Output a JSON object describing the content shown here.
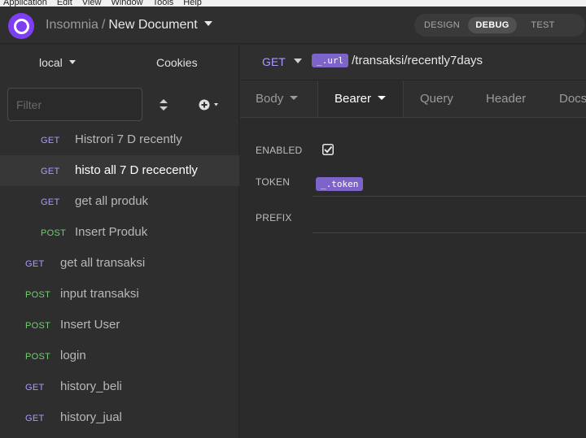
{
  "menubar": [
    "Application",
    "Edit",
    "View",
    "Window",
    "Tools",
    "Help"
  ],
  "header": {
    "app_name": "Insomnia",
    "separator": "/",
    "document": "New Document",
    "modes": [
      "DESIGN",
      "DEBUG",
      "TEST"
    ],
    "active_mode": "DEBUG"
  },
  "sidebar": {
    "environment": "local",
    "cookies_label": "Cookies",
    "filter_placeholder": "Filter",
    "requests": [
      {
        "method": "GET",
        "name": "Histrori 7 D recently",
        "indent": 1,
        "active": false
      },
      {
        "method": "GET",
        "name": "histo all 7 D rececently",
        "indent": 1,
        "active": true
      },
      {
        "method": "GET",
        "name": "get all produk",
        "indent": 1,
        "active": false
      },
      {
        "method": "POST",
        "name": "Insert Produk",
        "indent": 1,
        "active": false
      },
      {
        "method": "GET",
        "name": "get all transaksi",
        "indent": 0,
        "active": false
      },
      {
        "method": "POST",
        "name": "input transaksi",
        "indent": 0,
        "active": false
      },
      {
        "method": "POST",
        "name": "Insert User",
        "indent": 0,
        "active": false
      },
      {
        "method": "POST",
        "name": "login",
        "indent": 0,
        "active": false
      },
      {
        "method": "GET",
        "name": "history_beli",
        "indent": 0,
        "active": false
      },
      {
        "method": "GET",
        "name": "history_jual",
        "indent": 0,
        "active": false
      }
    ]
  },
  "request": {
    "method": "GET",
    "url_tag": "_.url",
    "url_path": "/transaksi/recently7days",
    "tabs": [
      "Body",
      "Bearer",
      "Query",
      "Header",
      "Docs"
    ],
    "active_tab": "Bearer"
  },
  "auth": {
    "enabled_label": "ENABLED",
    "enabled": true,
    "token_label": "TOKEN",
    "token_tag": "_.token",
    "prefix_label": "PREFIX",
    "prefix_value": ""
  },
  "colors": {
    "brand": "#7e3ff2",
    "get": "#a99bff",
    "post": "#6fd06f",
    "tag": "#7e63c8"
  }
}
